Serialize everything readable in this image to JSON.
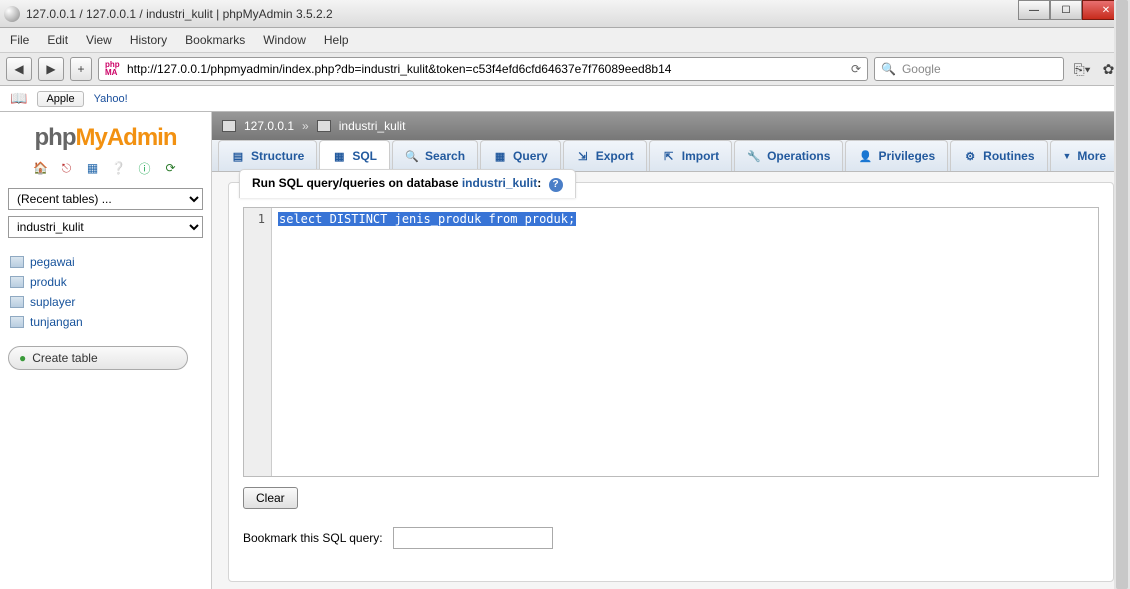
{
  "window": {
    "title": "127.0.0.1 / 127.0.0.1 / industri_kulit | phpMyAdmin 3.5.2.2"
  },
  "menubar": [
    "File",
    "Edit",
    "View",
    "History",
    "Bookmarks",
    "Window",
    "Help"
  ],
  "url": "http://127.0.0.1/phpmyadmin/index.php?db=industri_kulit&token=c53f4efd6cfd64637e7f76089eed8b14",
  "pma_badge": "php\nMA",
  "search": {
    "placeholder": "Google"
  },
  "bookmarks": {
    "apple": "Apple",
    "yahoo": "Yahoo!"
  },
  "logo": {
    "php": "php",
    "myadmin": "MyAdmin"
  },
  "sidebar": {
    "recent_label": "(Recent tables) ...",
    "db": "industri_kulit",
    "tables": [
      "pegawai",
      "produk",
      "suplayer",
      "tunjangan"
    ],
    "create": "Create table"
  },
  "breadcrumb": {
    "host": "127.0.0.1",
    "db": "industri_kulit"
  },
  "tabs": [
    "Structure",
    "SQL",
    "Search",
    "Query",
    "Export",
    "Import",
    "Operations",
    "Privileges",
    "Routines",
    "More"
  ],
  "active_tab": "SQL",
  "runlabel": {
    "prefix": "Run SQL query/queries on database ",
    "db": "industri_kulit",
    "suffix": ":"
  },
  "sql": {
    "line": "1",
    "query": "select DISTINCT jenis_produk from produk;"
  },
  "buttons": {
    "clear": "Clear"
  },
  "bookmark_query": {
    "label": "Bookmark this SQL query:",
    "value": ""
  }
}
